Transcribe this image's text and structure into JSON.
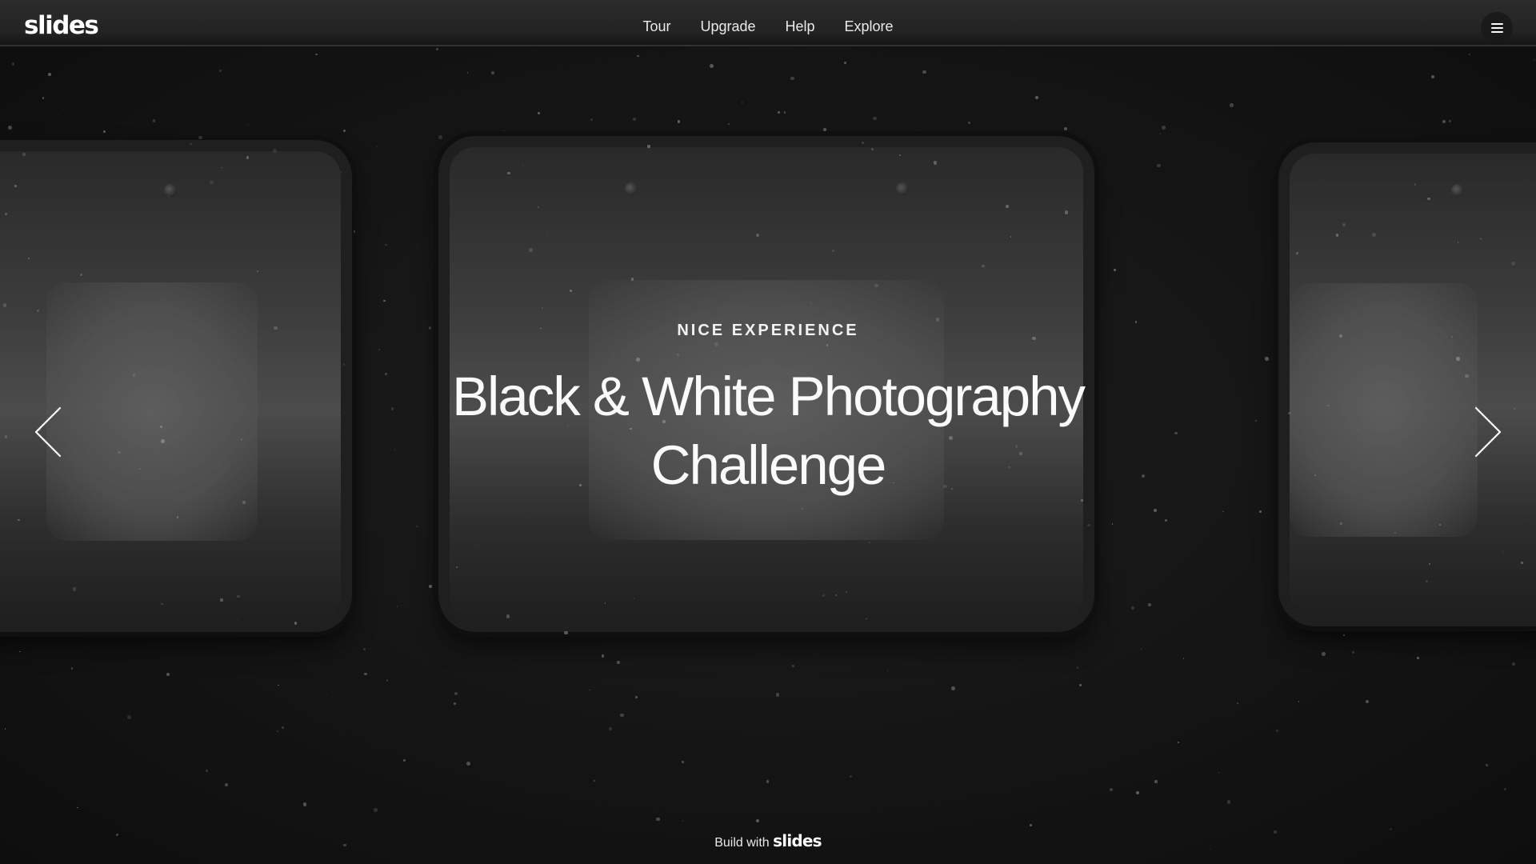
{
  "brand": {
    "logo": "slides"
  },
  "nav": {
    "items": [
      {
        "label": "Tour"
      },
      {
        "label": "Upgrade"
      },
      {
        "label": "Help"
      },
      {
        "label": "Explore"
      }
    ]
  },
  "menu": {
    "icon": "hamburger-menu-icon"
  },
  "hero": {
    "eyebrow": "NICE EXPERIENCE",
    "title_line1": "Black & White Photography",
    "title_line2": "Challenge"
  },
  "arrows": {
    "prev_icon": "chevron-left-icon",
    "next_icon": "chevron-right-icon"
  },
  "footer": {
    "prefix": "Build with",
    "brand": "slides"
  },
  "colors": {
    "text": "#ffffff",
    "background": "#1a1a1a"
  }
}
